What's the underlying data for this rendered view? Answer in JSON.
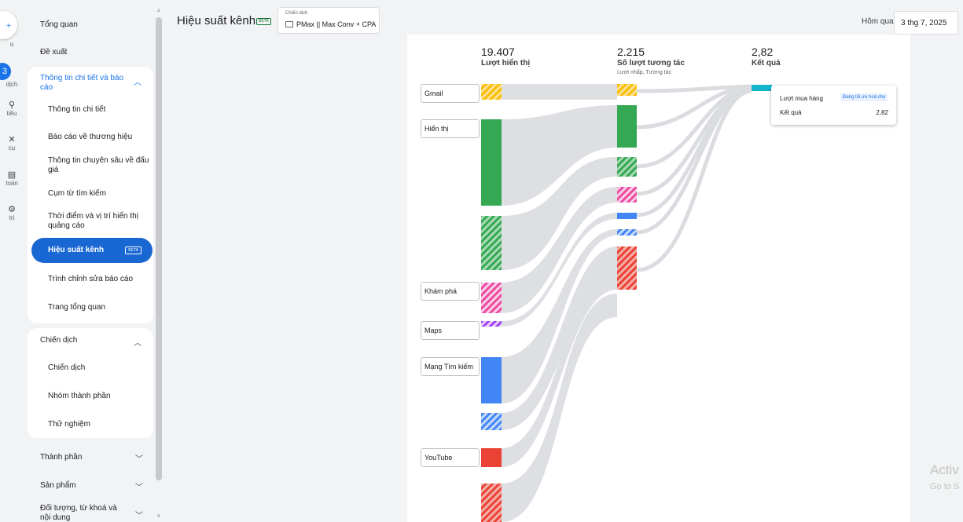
{
  "rail": {
    "items": [
      {
        "icon": "+",
        "label": "o"
      },
      {
        "icon": "3",
        "label": "dịch"
      },
      {
        "icon": "⚲",
        "label": "tiêu"
      },
      {
        "icon": "✕",
        "label": "cụ"
      },
      {
        "icon": "▤",
        "label": "toán"
      },
      {
        "icon": "⚙",
        "label": "trị"
      }
    ]
  },
  "sidebar": {
    "items": [
      {
        "label": "Tổng quan"
      },
      {
        "label": "Đề xuất"
      }
    ],
    "insights_group": {
      "label": "Thông tin chi tiết và báo cáo",
      "items": [
        {
          "label": "Thông tin chi tiết"
        },
        {
          "label": "Báo cáo về thương hiệu"
        },
        {
          "label": "Thông tin chuyên sâu về đấu giá"
        },
        {
          "label": "Cụm từ tìm kiếm"
        },
        {
          "label": "Thời điểm và vị trí hiển thị quảng cáo"
        },
        {
          "label": "Hiệu suất kênh",
          "badge": "BETA"
        },
        {
          "label": "Trình chỉnh sửa báo cáo"
        },
        {
          "label": "Trang tổng quan"
        }
      ]
    },
    "campaign_group": {
      "label": "Chiến dịch",
      "items": [
        {
          "label": "Chiến dịch"
        },
        {
          "label": "Nhóm thành phần"
        },
        {
          "label": "Thử nghiệm"
        }
      ]
    },
    "bottom_items": [
      {
        "label": "Thành phần"
      },
      {
        "label": "Sản phẩm"
      },
      {
        "label": "Đối tượng, từ khoá và nội dung"
      }
    ]
  },
  "header": {
    "title": "Hiệu suất kênh",
    "title_badge": "BETA",
    "campaign_label": "Chiến dịch",
    "campaign_value": "PMax || Max Conv + CPA",
    "date_range_label": "Hôm qua",
    "date_value": "3 thg 7, 2025"
  },
  "sankey": {
    "metrics": [
      {
        "value": "19.407",
        "label": "Lượt hiển thị",
        "sub": ""
      },
      {
        "value": "2.215",
        "label": "Số lượt tương tác",
        "sub": "Lượt nhấp, Tương tác"
      },
      {
        "value": "2,82",
        "label": "Kết quả",
        "sub": ""
      }
    ],
    "sources": [
      "Gmail",
      "Hiển thị",
      "Khám phá",
      "Maps",
      "Mạng Tìm kiếm",
      "YouTube"
    ],
    "colors": {
      "gmail": "#fbbc04",
      "display": "#34a853",
      "discover": "#ea4ca0",
      "maps": "#a142f4",
      "search": "#4285f4",
      "youtube": "#ea4335",
      "result": "#12b5cb",
      "flow": "#dadce0"
    },
    "tooltip": {
      "title": "Lượt mua hàng",
      "badge": "Đang tối ưu hoá cho",
      "key": "Kết quả",
      "value": "2,82"
    }
  },
  "watermark": {
    "line1": "Activ",
    "line2": "Go to S"
  }
}
